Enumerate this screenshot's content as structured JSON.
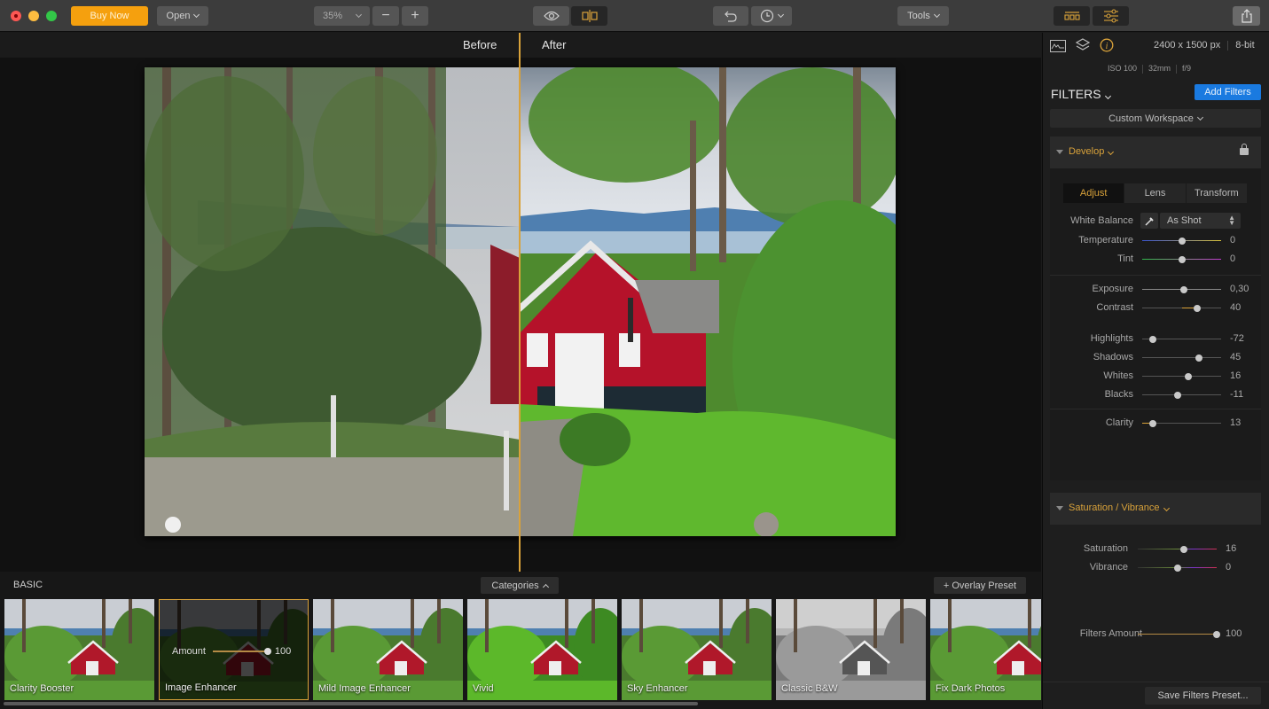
{
  "toolbar": {
    "buy_now": "Buy Now",
    "open": "Open",
    "zoom_level": "35%",
    "zoom_out": "−",
    "zoom_in": "+",
    "tools": "Tools",
    "icons": [
      "eye-icon",
      "compare-split-icon",
      "undo-icon",
      "history-clock-icon",
      "layout-panels-icon",
      "adjust-sliders-icon",
      "share-icon"
    ]
  },
  "canvas": {
    "before_label": "Before",
    "after_label": "After",
    "compare_position": 0.5
  },
  "presets": {
    "category": "BASIC",
    "categories_button": "Categories",
    "overlay_button": "+ Overlay Preset",
    "items": [
      {
        "label": "Clarity Booster",
        "style": "normal"
      },
      {
        "label": "Image Enhancer",
        "style": "selected",
        "amount_label": "Amount",
        "amount_value": "100",
        "amount": 100
      },
      {
        "label": "Mild Image Enhancer",
        "style": "normal"
      },
      {
        "label": "Vivid",
        "style": "vivid"
      },
      {
        "label": "Sky Enhancer",
        "style": "normal"
      },
      {
        "label": "Classic B&W",
        "style": "bw"
      },
      {
        "label": "Fix Dark Photos",
        "style": "normal"
      }
    ]
  },
  "panel": {
    "dimensions": "2400 x 1500 px",
    "bit_depth": "8-bit",
    "iso": "ISO 100",
    "focal": "32mm",
    "aperture": "f/9",
    "filters_title": "FILTERS",
    "add_filters": "Add Filters",
    "workspace": "Custom Workspace",
    "develop": {
      "title": "Develop",
      "tabs": [
        "Adjust",
        "Lens",
        "Transform"
      ],
      "active_tab": "Adjust",
      "white_balance_label": "White Balance",
      "white_balance_value": "As Shot",
      "sliders": [
        {
          "label": "Temperature",
          "value": "0",
          "pos": 0.5,
          "track": "temp"
        },
        {
          "label": "Tint",
          "value": "0",
          "pos": 0.5,
          "track": "tint"
        },
        {
          "label": "Exposure",
          "value": "0,30",
          "pos": 0.53,
          "track": "plain"
        },
        {
          "label": "Contrast",
          "value": "40",
          "pos": 0.7,
          "track": "center-fill"
        },
        {
          "label": "Highlights",
          "value": "-72",
          "pos": 0.14,
          "track": "plain"
        },
        {
          "label": "Shadows",
          "value": "45",
          "pos": 0.72,
          "track": "plain"
        },
        {
          "label": "Whites",
          "value": "16",
          "pos": 0.58,
          "track": "plain"
        },
        {
          "label": "Blacks",
          "value": "-11",
          "pos": 0.45,
          "track": "plain"
        },
        {
          "label": "Clarity",
          "value": "13",
          "pos": 0.14,
          "track": "left-fill"
        }
      ]
    },
    "saturation": {
      "title": "Saturation / Vibrance",
      "sliders": [
        {
          "label": "Saturation",
          "value": "16",
          "pos": 0.58
        },
        {
          "label": "Vibrance",
          "value": "0",
          "pos": 0.5
        }
      ]
    },
    "filters_amount_label": "Filters Amount",
    "filters_amount_value": "100",
    "filters_amount": 100,
    "save_preset": "Save Filters Preset..."
  },
  "colors": {
    "accent": "#d9a23a",
    "buy_now": "#f5a00e",
    "add_filters": "#1a7ae0"
  }
}
